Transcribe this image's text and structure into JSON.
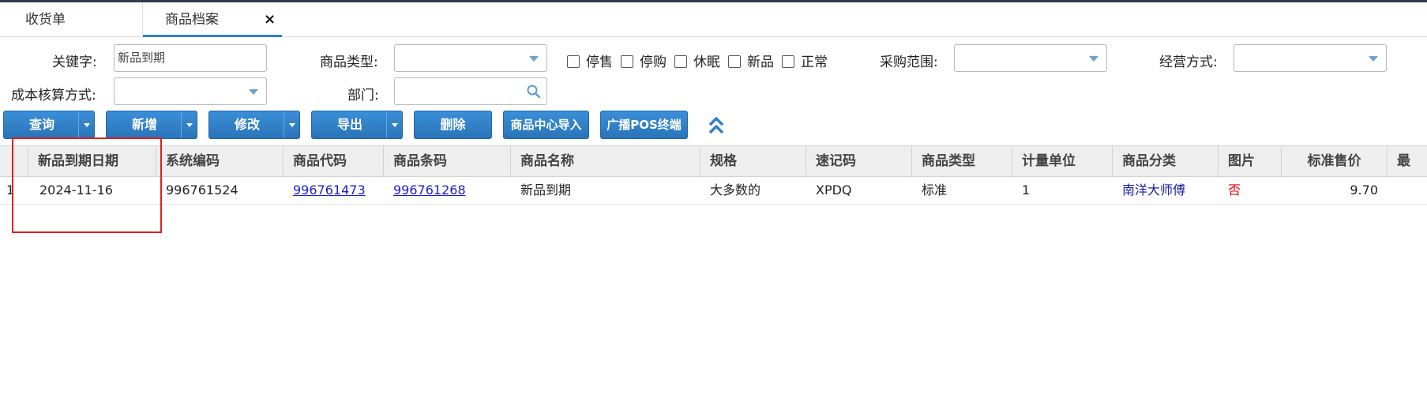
{
  "tabs": [
    {
      "label": "收货单"
    },
    {
      "label": "商品档案",
      "close": "×"
    }
  ],
  "filters": {
    "keyword_label": "关键字:",
    "keyword_value": "新品到期",
    "goods_type_label": "商品类型:",
    "goods_type_value": "",
    "checkboxes": [
      "停售",
      "停购",
      "休眠",
      "新品",
      "正常"
    ],
    "purchase_scope_label": "采购范围:",
    "purchase_scope_value": "",
    "operation_mode_label": "经营方式:",
    "operation_mode_value": "",
    "cost_method_label": "成本核算方式:",
    "cost_method_value": "",
    "dept_label": "部门:",
    "dept_value": ""
  },
  "toolbar": {
    "query": "查询",
    "add": "新增",
    "modify": "修改",
    "export": "导出",
    "delete": "删除",
    "import_center": "商品中心导入",
    "broadcast_pos": "广播POS终端"
  },
  "grid": {
    "columns": [
      "新品到期日期",
      "系统编码",
      "商品代码",
      "商品条码",
      "商品名称",
      "规格",
      "速记码",
      "商品类型",
      "计量单位",
      "商品分类",
      "图片",
      "标准售价",
      "最"
    ],
    "rows": [
      {
        "index": "1",
        "new_expiry_date": "2024-11-16",
        "system_code": "996761524",
        "goods_code": "996761473",
        "barcode": "996761268",
        "name": "新品到期",
        "spec": "大多数的",
        "shorthand": "XPDQ",
        "goods_type": "标准",
        "unit": "1",
        "category": "南洋大师傅",
        "image": "否",
        "std_price": "9.70"
      }
    ]
  },
  "colors": {
    "accent": "#2f80c8",
    "link": "#1a1adb",
    "highlight_box": "#e02020"
  }
}
